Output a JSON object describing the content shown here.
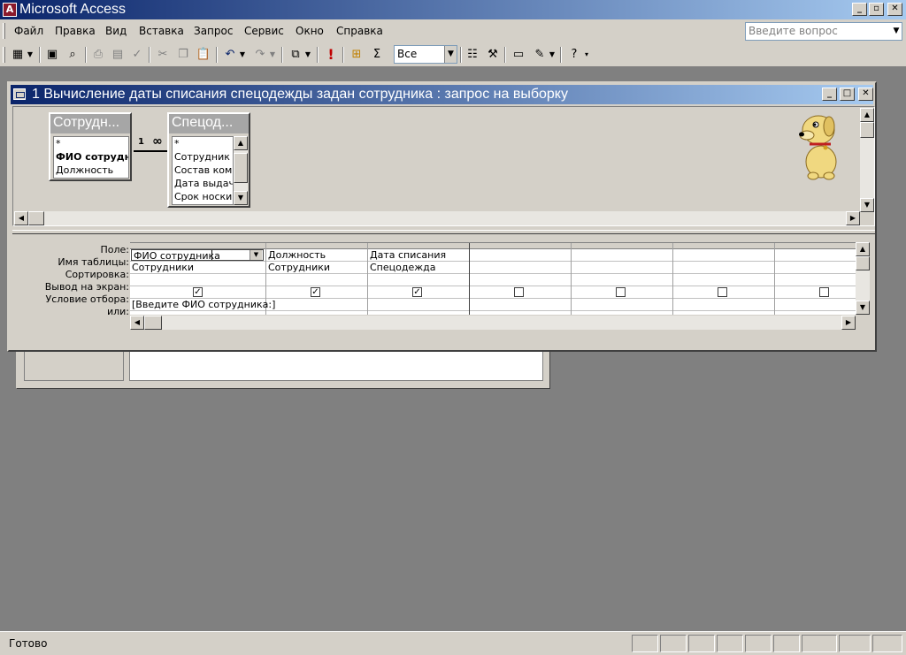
{
  "app": {
    "icon_letter": "A",
    "title": "Microsoft Access",
    "caption_buttons": [
      "_",
      "▫",
      "✕"
    ]
  },
  "menu": {
    "items": [
      "Файл",
      "Правка",
      "Вид",
      "Вставка",
      "Запрос",
      "Сервис",
      "Окно",
      "Справка"
    ],
    "ask_placeholder": "Введите вопрос"
  },
  "toolbar": {
    "top_values_combo": "Все",
    "run_icon": "!",
    "totals_icon": "Σ"
  },
  "query_window": {
    "title": "1 Вычисление даты списания спецодежды задан сотрудника : запрос на выборку",
    "tables": [
      {
        "name": "Сотрудн...",
        "fields": [
          "*",
          "ФИО сотрудника",
          "Должность"
        ]
      },
      {
        "name": "Спецод...",
        "fields": [
          "*",
          "Сотрудник",
          "Состав комп.",
          "Дата выдачи",
          "Срок носки ("
        ]
      }
    ],
    "relationship": {
      "one": "1",
      "many": "∞"
    },
    "grid": {
      "row_labels": [
        "Поле:",
        "Имя таблицы:",
        "Сортировка:",
        "Вывод на экран:",
        "Условие отбора:",
        "или:"
      ],
      "columns": [
        {
          "field": "ФИО сотрудника",
          "table": "Сотрудники",
          "sort": "",
          "show": true,
          "criteria": "[Введите ФИО сотрудника:]",
          "or": ""
        },
        {
          "field": "Должность",
          "table": "Сотрудники",
          "sort": "",
          "show": true,
          "criteria": "",
          "or": ""
        },
        {
          "field": "Дата списания",
          "table": "Спецодежда",
          "sort": "",
          "show": true,
          "criteria": "",
          "or": ""
        },
        {
          "field": "",
          "table": "",
          "sort": "",
          "show": false,
          "criteria": "",
          "or": ""
        },
        {
          "field": "",
          "table": "",
          "sort": "",
          "show": false,
          "criteria": "",
          "or": ""
        },
        {
          "field": "",
          "table": "",
          "sort": "",
          "show": false,
          "criteria": "",
          "or": ""
        },
        {
          "field": "",
          "table": "",
          "sort": "",
          "show": false,
          "criteria": "",
          "or": ""
        }
      ]
    }
  },
  "status": {
    "text": "Готово"
  }
}
